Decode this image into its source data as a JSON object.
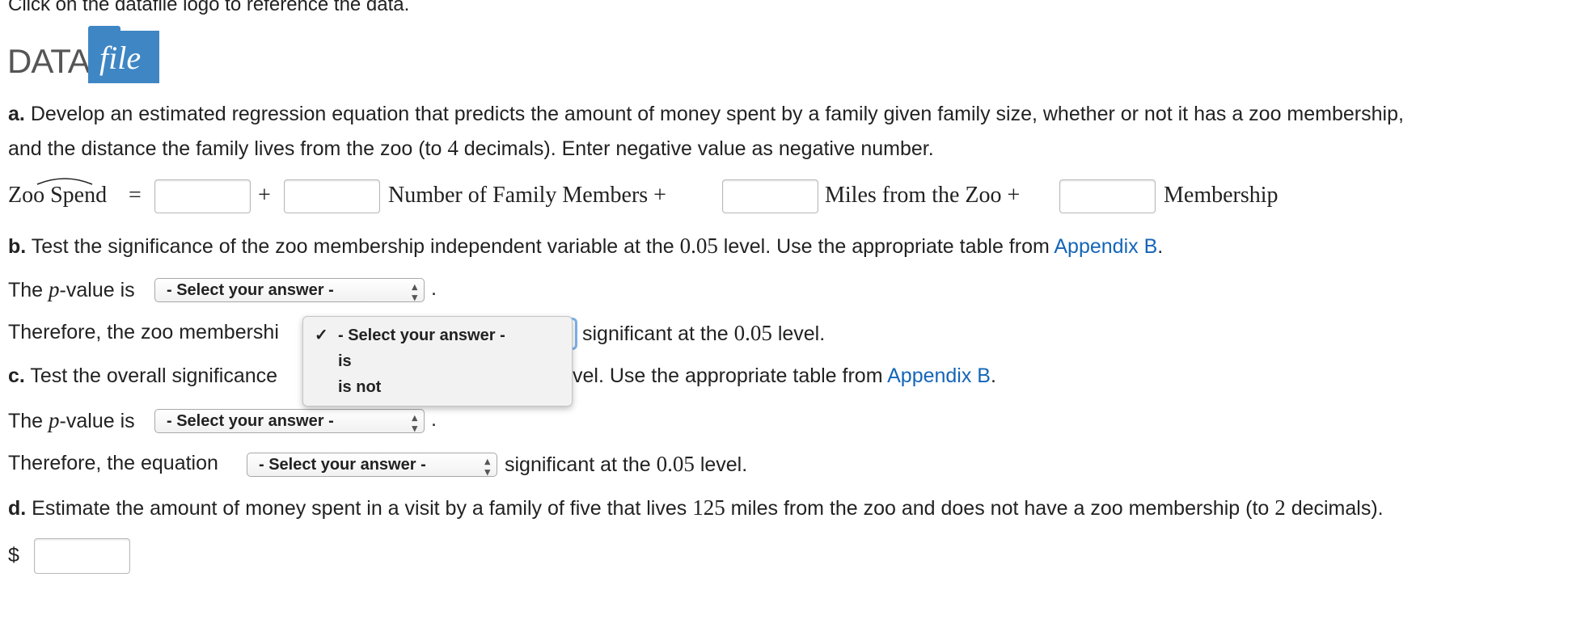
{
  "instruction": "Click on the datafile logo to reference the data.",
  "logo": {
    "data_text": "DATA",
    "file_text": "file"
  },
  "part_a": {
    "letter": "a.",
    "text_line1": "Develop an estimated regression equation that predicts the amount of money spent by a family given family size, whether or not it has a zoo membership,",
    "text_line2_pre": "and the distance the family lives from the zoo (to ",
    "decimals": "4",
    "text_line2_post": " decimals). Enter negative value as negative number.",
    "equation": {
      "lhs": "Zoo Spend",
      "equals": "=",
      "plus": "+",
      "term1": "Number of Family Members +",
      "term2": "Miles from the Zoo +",
      "term3": "Membership"
    }
  },
  "part_b": {
    "letter": "b.",
    "text_pre": "Test the significance of the zoo membership independent variable at the ",
    "alpha": "0.05",
    "text_post": " level. Use the appropriate table from ",
    "link": "Appendix B",
    "period": ".",
    "pvalue_prefix": "The ",
    "pvalue_p": "p",
    "pvalue_suffix": "-value is",
    "select_placeholder": "- Select your answer -",
    "therefore_visible": "Therefore, the zoo membershi",
    "therefore_after": "significant at the ",
    "therefore_alpha": "0.05",
    "therefore_end": " level.",
    "dropdown": {
      "check": "✓",
      "options": [
        "- Select your answer -",
        "is",
        "is not"
      ]
    }
  },
  "part_c": {
    "letter": "c.",
    "text_visible": "Test the overall significance",
    "text_after_popup": "vel. Use the appropriate table from ",
    "link": "Appendix B",
    "period": ".",
    "pvalue_prefix": "The ",
    "pvalue_p": "p",
    "pvalue_suffix": "-value is",
    "select_placeholder": "- Select your answer -",
    "therefore": "Therefore, the equation",
    "therefore_after": "significant at the ",
    "therefore_alpha": "0.05",
    "therefore_end": " level."
  },
  "part_d": {
    "letter": "d.",
    "text_pre": "Estimate the amount of money spent in a visit by a family of five that lives ",
    "miles": "125",
    "text_mid": " miles from the zoo and does not have a zoo membership (to ",
    "decimals": "2",
    "text_post": " decimals).",
    "currency": "$"
  }
}
